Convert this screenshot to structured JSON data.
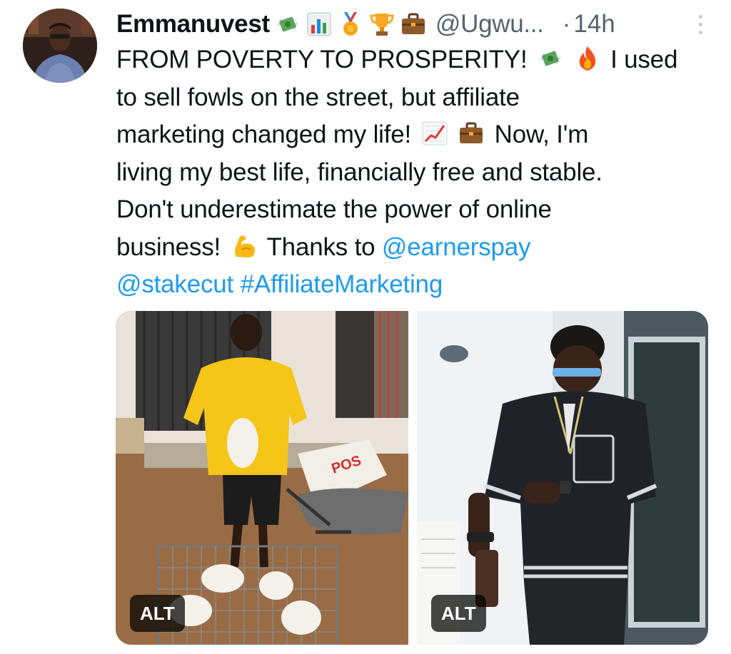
{
  "user": {
    "display_name": "Emmanuvest",
    "badges": [
      "money-with-wings",
      "bar-chart",
      "medal",
      "trophy",
      "briefcase"
    ],
    "handle": "@Ugwu...",
    "dot": "·",
    "time": "14h"
  },
  "tweet": {
    "line1_a": "FROM POVERTY TO PROSPERITY!",
    "line1_b": "I used",
    "line2": "to sell fowls on the street, but affiliate",
    "line3_a": "marketing changed my life!",
    "line3_b": "Now, I'm",
    "line4": "living my best life, financially free and stable.",
    "line5": "Don't underestimate the power of online",
    "line6_a": "business!",
    "line6_b": "Thanks to",
    "mention1": "@earnerspay",
    "mention2": "@stakecut",
    "hashtag": "#AffiliateMarketing",
    "emojis": [
      "money-with-wings",
      "fire",
      "chart-increasing",
      "briefcase",
      "flexed-biceps"
    ]
  },
  "media": {
    "photos": [
      {
        "alt_label": "ALT",
        "depicts": "man-with-chickens"
      },
      {
        "alt_label": "ALT",
        "depicts": "man-in-kaftan"
      }
    ],
    "photo_sign_text": "POS"
  },
  "colors": {
    "link": "#1d9bf0",
    "muted": "#536471",
    "text": "#0f1419"
  }
}
